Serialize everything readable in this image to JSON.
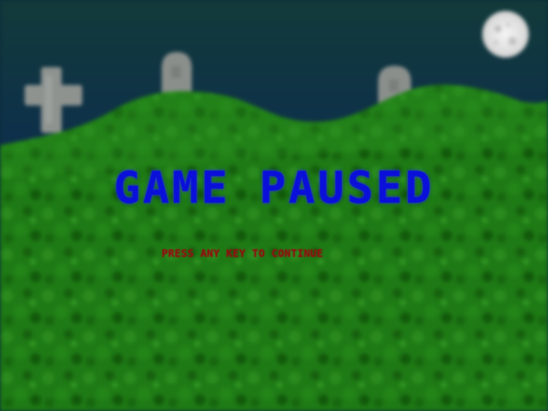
{
  "game": {
    "state": "paused",
    "title": "GAME PAUSED",
    "hint": "PRESS ANY KEY TO CONTINUE"
  },
  "scene": {
    "objects": {
      "moon": "full-moon",
      "grave_markers": [
        "cross-gravestone",
        "rounded-tombstone",
        "rounded-tombstone"
      ],
      "terrain": "grassy-hills"
    },
    "colors": {
      "sky_top": "#103838",
      "sky_bottom": "#0a1f5c",
      "grass": "#1f7a14",
      "grass_dark": "#145a0c",
      "stone": "#8a8f8c",
      "moon": "#e8e8e8",
      "title": "#0a10d8",
      "hint": "#8c1010"
    }
  }
}
